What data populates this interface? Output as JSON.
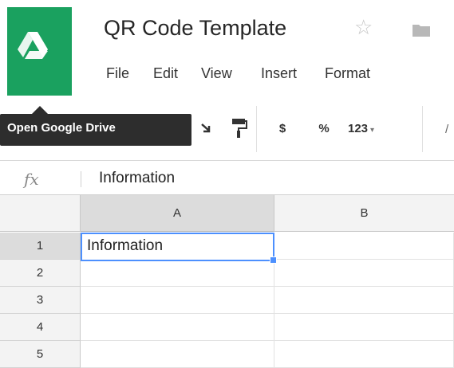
{
  "app": {
    "title": "QR Code Template",
    "star_icon": "☆",
    "folder_icon": "folder-icon",
    "drive_logo": "google-drive-logo"
  },
  "menu": {
    "items": [
      "File",
      "Edit",
      "View",
      "Insert",
      "Format"
    ]
  },
  "tooltip": {
    "text": "Open Google Drive"
  },
  "toolbar": {
    "currency_label": "$",
    "percent_label": "%",
    "number_format_label": "123",
    "number_format_caret": "▾",
    "partial_label": "/"
  },
  "formula_bar": {
    "fx_label": "fx",
    "value": "Information"
  },
  "sheet": {
    "columns": [
      "A",
      "B"
    ],
    "rows": [
      "1",
      "2",
      "3",
      "4",
      "5"
    ],
    "selected_cell": "A1",
    "a1_value": "Information"
  },
  "colors": {
    "drive_green": "#1aa15f",
    "selection_blue": "#4d90fe",
    "tooltip_bg": "#2d2d2d"
  }
}
